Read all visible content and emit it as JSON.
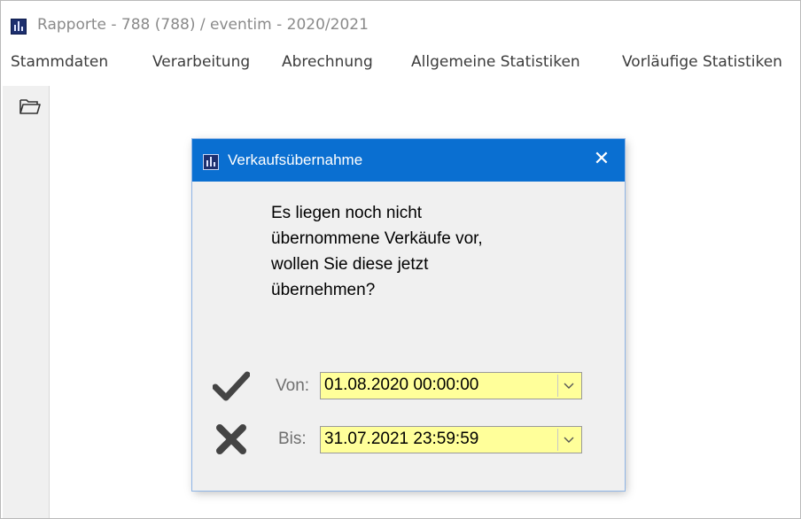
{
  "window": {
    "title": "Rapporte  -  788 (788) / eventim  -  2020/2021"
  },
  "menu": {
    "items": [
      {
        "label": "Stammdaten"
      },
      {
        "label": "Verarbeitung"
      },
      {
        "label": "Abrechnung"
      },
      {
        "label": "Allgemeine Statistiken"
      },
      {
        "label": "Vorläufige Statistiken"
      }
    ]
  },
  "toolbar": {
    "folder_icon": "folder-open-icon"
  },
  "dialog": {
    "title": "Verkaufsübernahme",
    "close_glyph": "✕",
    "message_lines": [
      "Es liegen noch nicht",
      "übernommene Verkäufe vor,",
      "wollen Sie diese jetzt",
      "übernehmen?"
    ],
    "from": {
      "label": "Von:",
      "value": "01.08.2020 00:00:00"
    },
    "to": {
      "label": "Bis:",
      "value": "31.07.2021 23:59:59"
    },
    "accent_color": "#0a6fd1",
    "field_color": "#ffff9a"
  }
}
